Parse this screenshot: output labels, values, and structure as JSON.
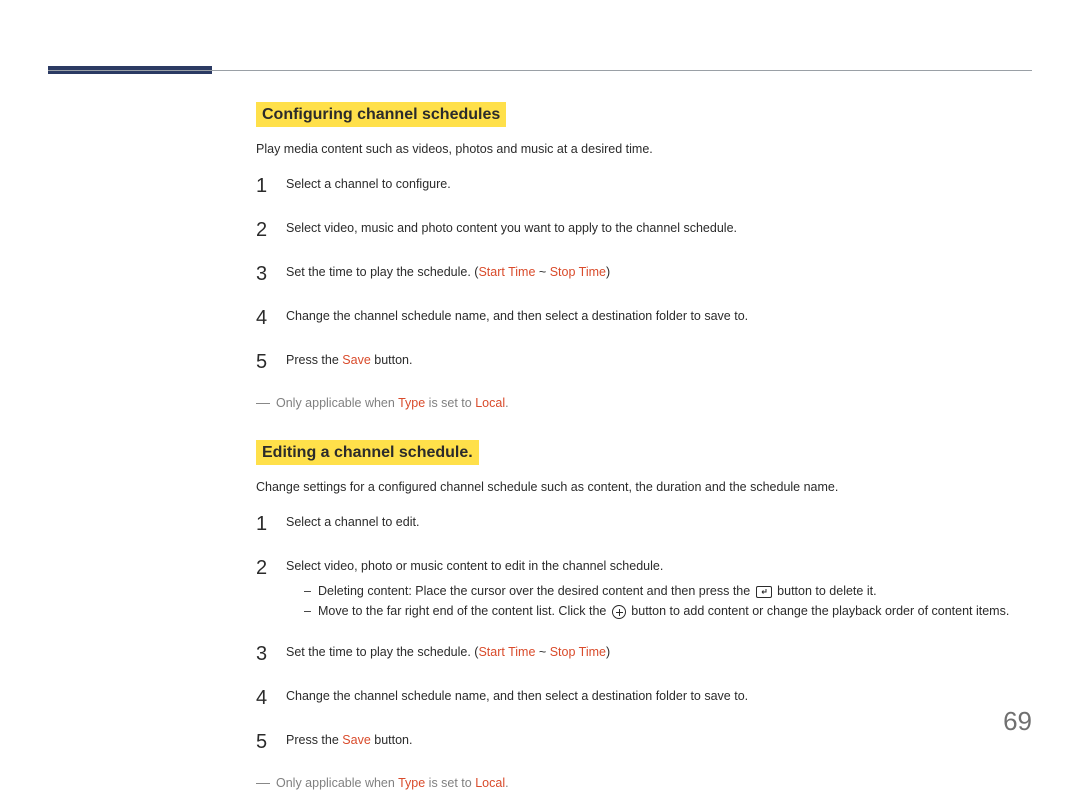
{
  "page_number": "69",
  "section1": {
    "heading": "Configuring channel schedules",
    "intro": "Play media content such as videos, photos and music at a desired time.",
    "steps": {
      "s1": "Select a channel to configure.",
      "s2": "Select video, music and photo content you want to apply to the channel schedule.",
      "s3_a": "Set the time to play the schedule. (",
      "s3_start": "Start Time",
      "s3_tilde": " ~ ",
      "s3_stop": "Stop Time",
      "s3_b": ")",
      "s4": "Change the channel schedule name, and then select a destination folder to save to.",
      "s5_a": "Press the ",
      "s5_save": "Save",
      "s5_b": " button."
    },
    "note_a": "Only applicable when ",
    "note_type": "Type",
    "note_b": " is set to ",
    "note_local": "Local",
    "note_c": "."
  },
  "section2": {
    "heading": "Editing a channel schedule.",
    "intro": "Change settings for a configured channel schedule such as content, the duration and the schedule name.",
    "steps": {
      "s1": "Select a channel to edit.",
      "s2": "Select video, photo or music content to edit in the channel schedule.",
      "s2_sub1_a": "Deleting content: Place the cursor over the desired content and then press the ",
      "s2_sub1_b": " button to delete it.",
      "s2_sub2_a": "Move to the far right end of the content list. Click the ",
      "s2_sub2_b": " button to add content or change the playback order of content items.",
      "s3_a": "Set the time to play the schedule. (",
      "s3_start": "Start Time",
      "s3_tilde": " ~ ",
      "s3_stop": "Stop Time",
      "s3_b": ")",
      "s4": "Change the channel schedule name, and then select a destination folder to save to.",
      "s5_a": "Press the ",
      "s5_save": "Save",
      "s5_b": " button."
    },
    "note_a": "Only applicable when ",
    "note_type": "Type",
    "note_b": " is set to ",
    "note_local": "Local",
    "note_c": "."
  }
}
